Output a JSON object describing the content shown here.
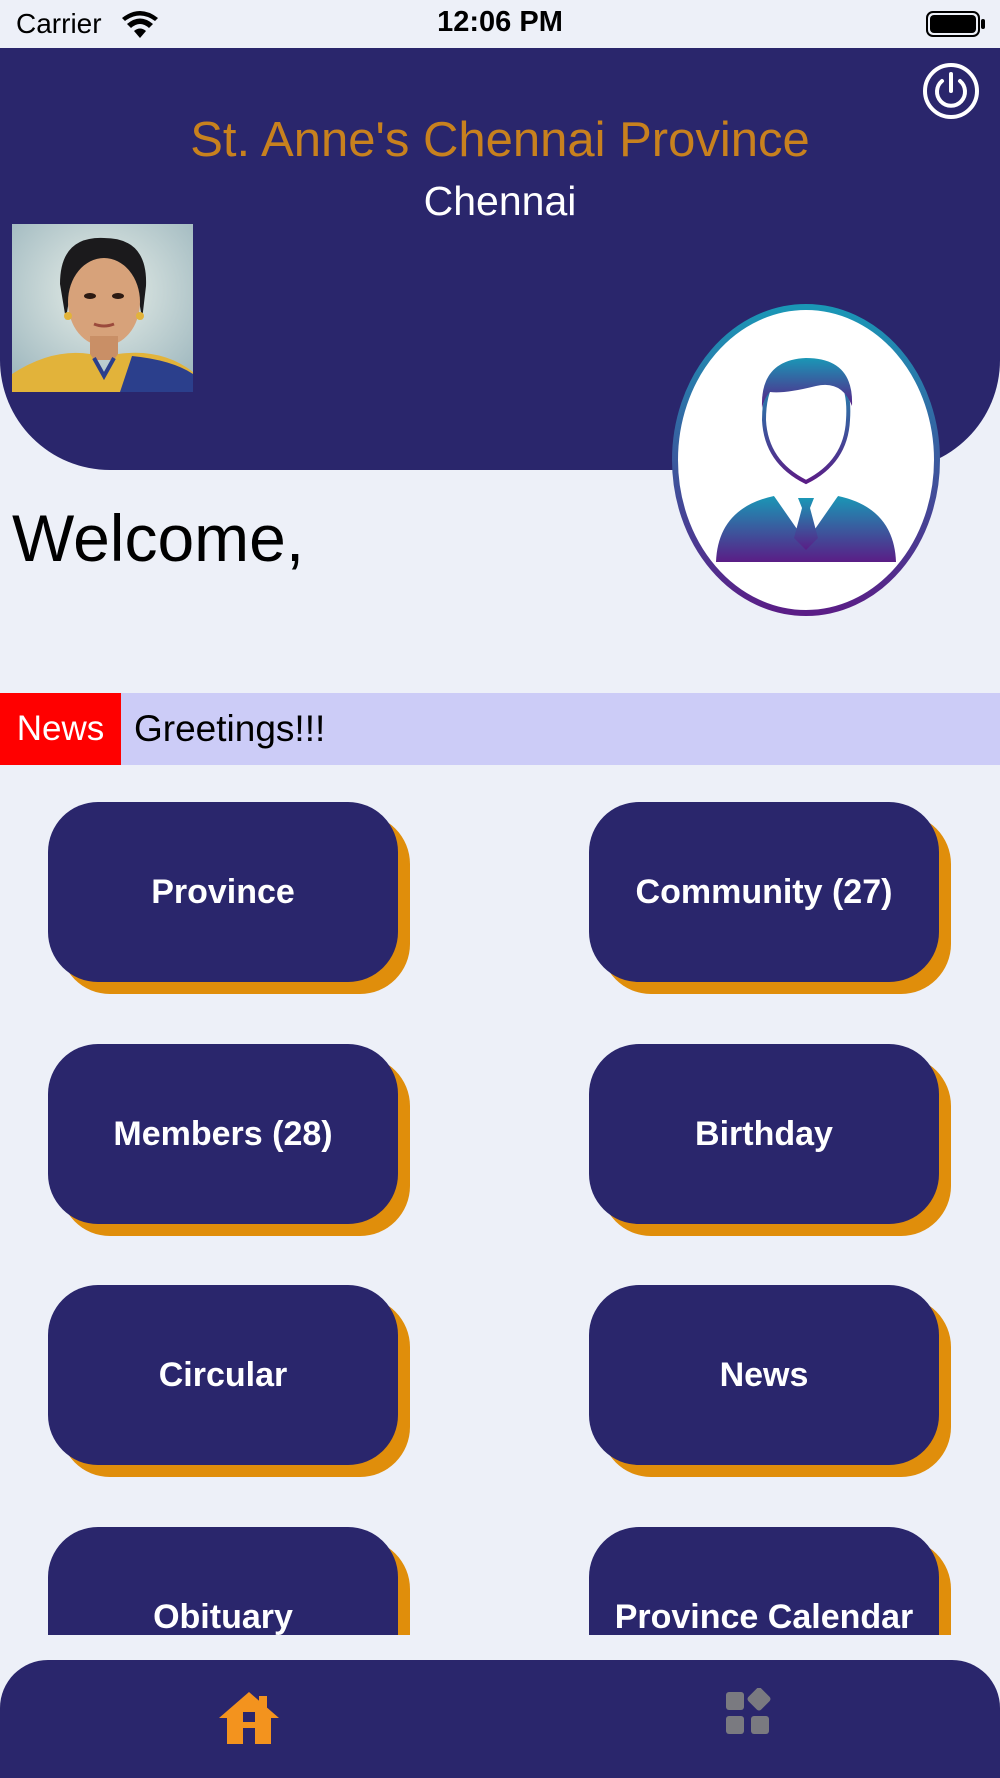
{
  "status_bar": {
    "carrier": "Carrier",
    "time": "12:06 PM"
  },
  "header": {
    "title": "St. Anne's Chennai Province",
    "subtitle": "Chennai"
  },
  "welcome": {
    "text": "Welcome,"
  },
  "news": {
    "tag": "News",
    "ticker": "Greetings!!!"
  },
  "menu": {
    "tiles": [
      {
        "label": "Province"
      },
      {
        "label": "Community (27)"
      },
      {
        "label": "Members (28)"
      },
      {
        "label": "Birthday"
      },
      {
        "label": "Circular"
      },
      {
        "label": "News"
      },
      {
        "label": "Obituary"
      },
      {
        "label": "Province Calendar"
      }
    ]
  },
  "tabbar": {
    "items": [
      {
        "icon": "home-icon",
        "active": true
      },
      {
        "icon": "apps-icon",
        "active": false
      }
    ]
  },
  "colors": {
    "header_bg": "#2a266c",
    "accent_orange": "#e08e0b",
    "title_gold": "#c8811e",
    "news_tag": "#ff0000",
    "news_bar": "#ccccf7",
    "page_bg": "#edf0f8"
  }
}
